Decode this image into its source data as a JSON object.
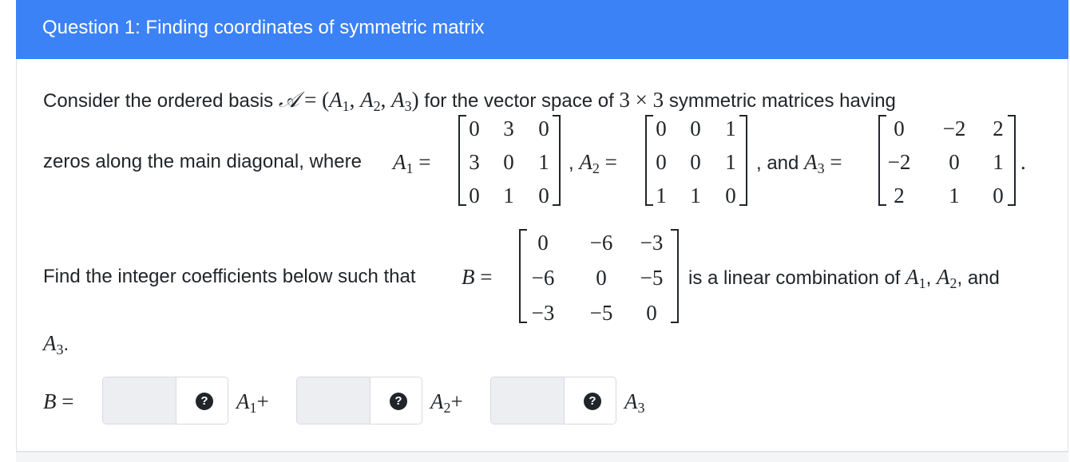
{
  "header": {
    "title": "Question 1: Finding coordinates of symmetric matrix"
  },
  "para1": {
    "t1": "Consider the ordered basis ",
    "basis_symbol": "𝒜",
    "eq": " = ",
    "open": "(",
    "a": "A",
    "s1": "1",
    "comma1": ", ",
    "s2": "2",
    "comma2": ", ",
    "s3": "3",
    "close": ")",
    "t2": " for the vector space of ",
    "three1": "3",
    "times": " × ",
    "three2": "3",
    "t3": " symmetric matrices having"
  },
  "para2": {
    "t1": "zeros along the main diagonal, where ",
    "a": "A",
    "s1": "1",
    "eq": " =",
    "sep1": ",",
    "s2": "2",
    "sep2": ", and",
    "s3": "3",
    "end": "."
  },
  "matrices": {
    "A1": [
      [
        "0",
        "3",
        "0"
      ],
      [
        "3",
        "0",
        "1"
      ],
      [
        "0",
        "1",
        "0"
      ]
    ],
    "A2": [
      [
        "0",
        "0",
        "1"
      ],
      [
        "0",
        "0",
        "1"
      ],
      [
        "1",
        "1",
        "0"
      ]
    ],
    "A3": [
      [
        "0",
        "−2",
        "2"
      ],
      [
        "−2",
        "0",
        "1"
      ],
      [
        "2",
        "1",
        "0"
      ]
    ],
    "B": [
      [
        "0",
        "−6",
        "−3"
      ],
      [
        "−6",
        "0",
        "−5"
      ],
      [
        "−3",
        "−5",
        "0"
      ]
    ]
  },
  "para3": {
    "t1": "Find the integer coefficients below such that ",
    "b": "B",
    "eq": " =",
    "t2": " is a linear combination of ",
    "a": "A",
    "s1": "1",
    "comma": ",",
    "s2": "2",
    "and": ", and",
    "s3": "3",
    "end": "."
  },
  "answer": {
    "b": "B",
    "eq": " =",
    "a": "A",
    "s1": "1",
    "plus1": "+",
    "s2": "2",
    "plus2": "+",
    "s3": "3",
    "help_glyph": "?",
    "inputs": [
      {
        "value": "",
        "placeholder": ""
      },
      {
        "value": "",
        "placeholder": ""
      },
      {
        "value": "",
        "placeholder": ""
      }
    ]
  }
}
